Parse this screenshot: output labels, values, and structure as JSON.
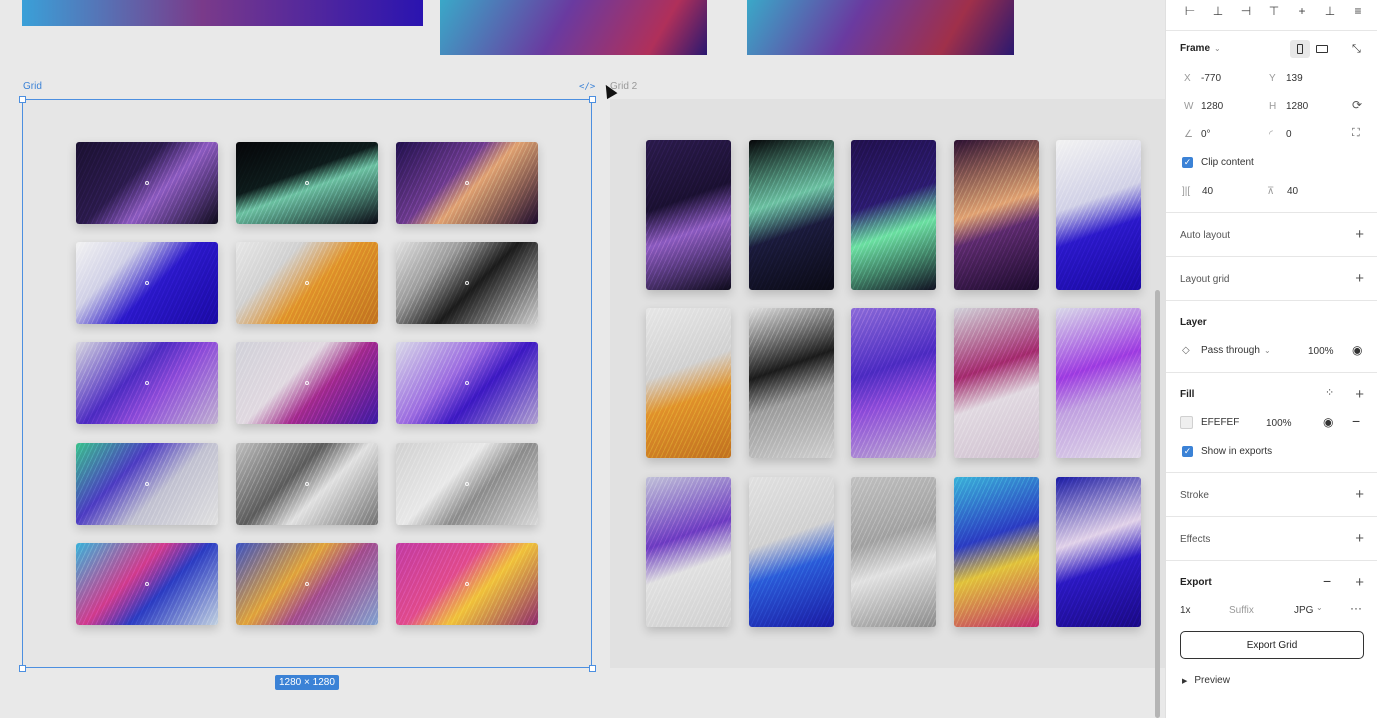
{
  "canvas": {
    "grid_label": "Grid",
    "grid2_label": "Grid 2",
    "size_badge": "1280 × 1280",
    "code_icon": "</>"
  },
  "panel": {
    "frame": {
      "title": "Frame",
      "x_label": "X",
      "x_value": "-770",
      "y_label": "Y",
      "y_value": "139",
      "w_label": "W",
      "w_value": "1280",
      "h_label": "H",
      "h_value": "1280",
      "rotation": "0°",
      "radius": "0",
      "clip_content": "Clip content",
      "gap_h": "40",
      "gap_v": "40"
    },
    "auto_layout": "Auto layout",
    "layout_grid": "Layout grid",
    "layer": {
      "title": "Layer",
      "blend": "Pass through",
      "opacity": "100%"
    },
    "fill": {
      "title": "Fill",
      "hex": "EFEFEF",
      "opacity": "100%",
      "show_in_exports": "Show in exports",
      "swatch_color": "#EFEFEF"
    },
    "stroke": "Stroke",
    "effects": "Effects",
    "export": {
      "title": "Export",
      "scale": "1x",
      "suffix_placeholder": "Suffix",
      "format": "JPG",
      "button": "Export Grid",
      "preview": "Preview"
    }
  },
  "colors": {
    "selection": "#4c8fe0",
    "accent": "#3b82d6"
  }
}
